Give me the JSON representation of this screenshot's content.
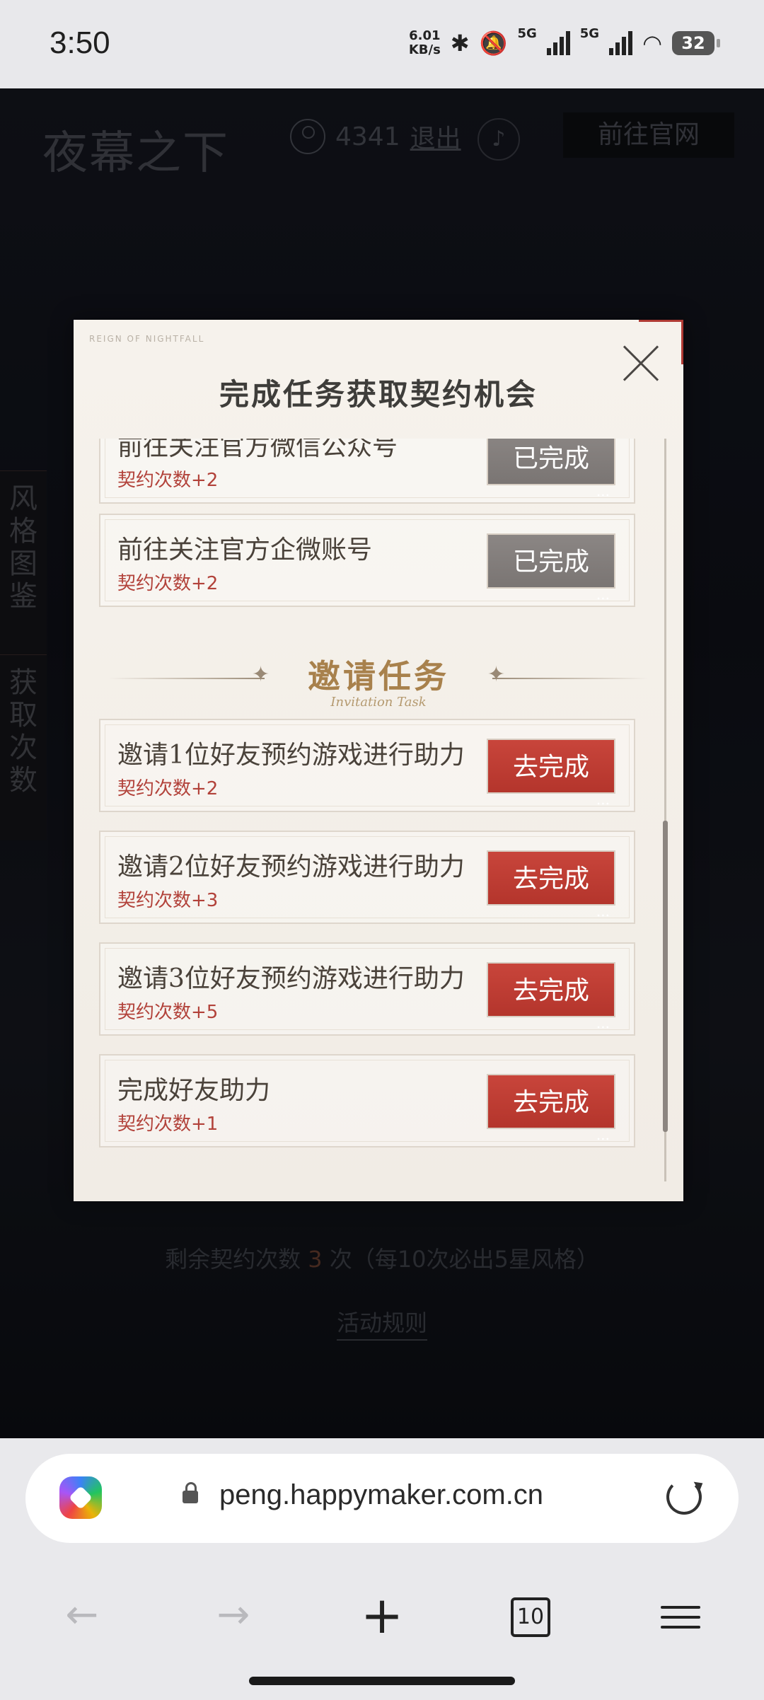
{
  "status_bar": {
    "time": "3:50",
    "net_speed_value": "6.01",
    "net_speed_unit": "KB/s",
    "signal_1": "5G",
    "signal_2": "5G",
    "battery": "32"
  },
  "page": {
    "logo": "夜幕之下",
    "user_id": "4341",
    "logout_label": "退出",
    "official_site_label": "前往官网",
    "side_tabs": [
      "风格图鉴",
      "获取次数"
    ],
    "remaining_prefix": "剩余契约次数",
    "remaining_count": "3",
    "remaining_suffix": "次（每10次必出5星风格）",
    "rules_label": "活动规则"
  },
  "modal": {
    "brand": "REIGN OF NIGHTFALL",
    "title": "完成任务获取契约机会",
    "section_title": "邀请任务",
    "section_subtitle": "Invitation Task",
    "tasks": [
      {
        "name": "前往关注官方微信公众号",
        "reward": "契约次数+2",
        "button": "已完成",
        "state": "done"
      },
      {
        "name": "前往关注官方企微账号",
        "reward": "契约次数+2",
        "button": "已完成",
        "state": "done"
      },
      {
        "name": "邀请1位好友预约游戏进行助力",
        "reward": "契约次数+2",
        "button": "去完成",
        "state": "todo"
      },
      {
        "name": "邀请2位好友预约游戏进行助力",
        "reward": "契约次数+3",
        "button": "去完成",
        "state": "todo"
      },
      {
        "name": "邀请3位好友预约游戏进行助力",
        "reward": "契约次数+5",
        "button": "去完成",
        "state": "todo"
      },
      {
        "name": "完成好友助力",
        "reward": "契约次数+1",
        "button": "去完成",
        "state": "todo"
      }
    ]
  },
  "browser": {
    "url": "peng.happymaker.com.cn",
    "tab_count": "10"
  }
}
